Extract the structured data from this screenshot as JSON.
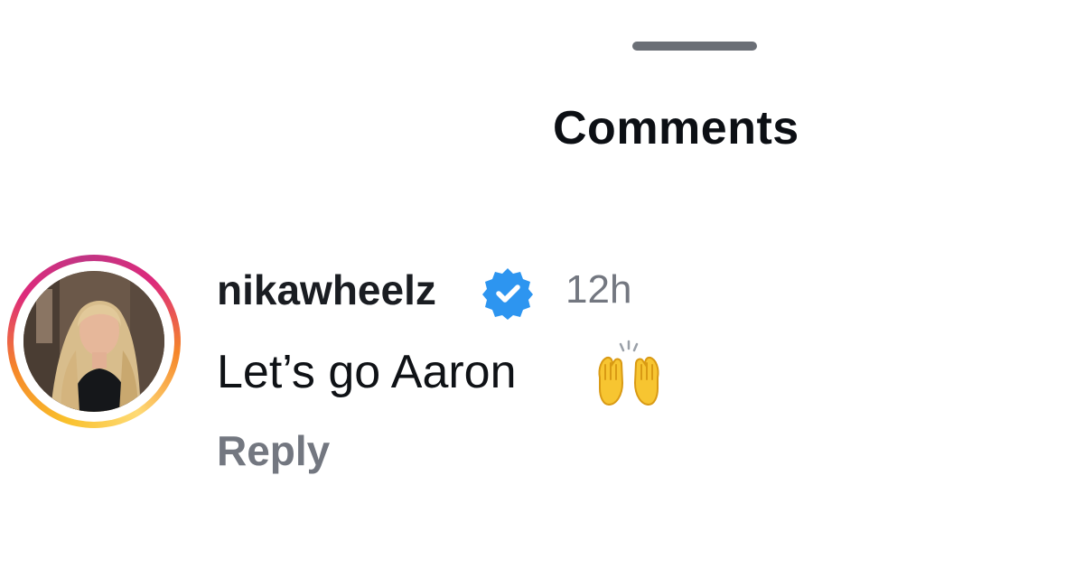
{
  "sheet": {
    "title": "Comments"
  },
  "comment": {
    "username": "nikawheelz",
    "verified": true,
    "timestamp": "12h",
    "text": "Let’s go Aaron",
    "emoji_icon": "raising-hands-emoji-icon",
    "reply_label": "Reply",
    "avatar_has_story_ring": true
  },
  "colors": {
    "verified_badge": "#2d95f0",
    "secondary_text": "#737780",
    "primary_text": "#0f1216",
    "story_ring_start": "#f9c02b",
    "story_ring_end": "#c13584"
  }
}
